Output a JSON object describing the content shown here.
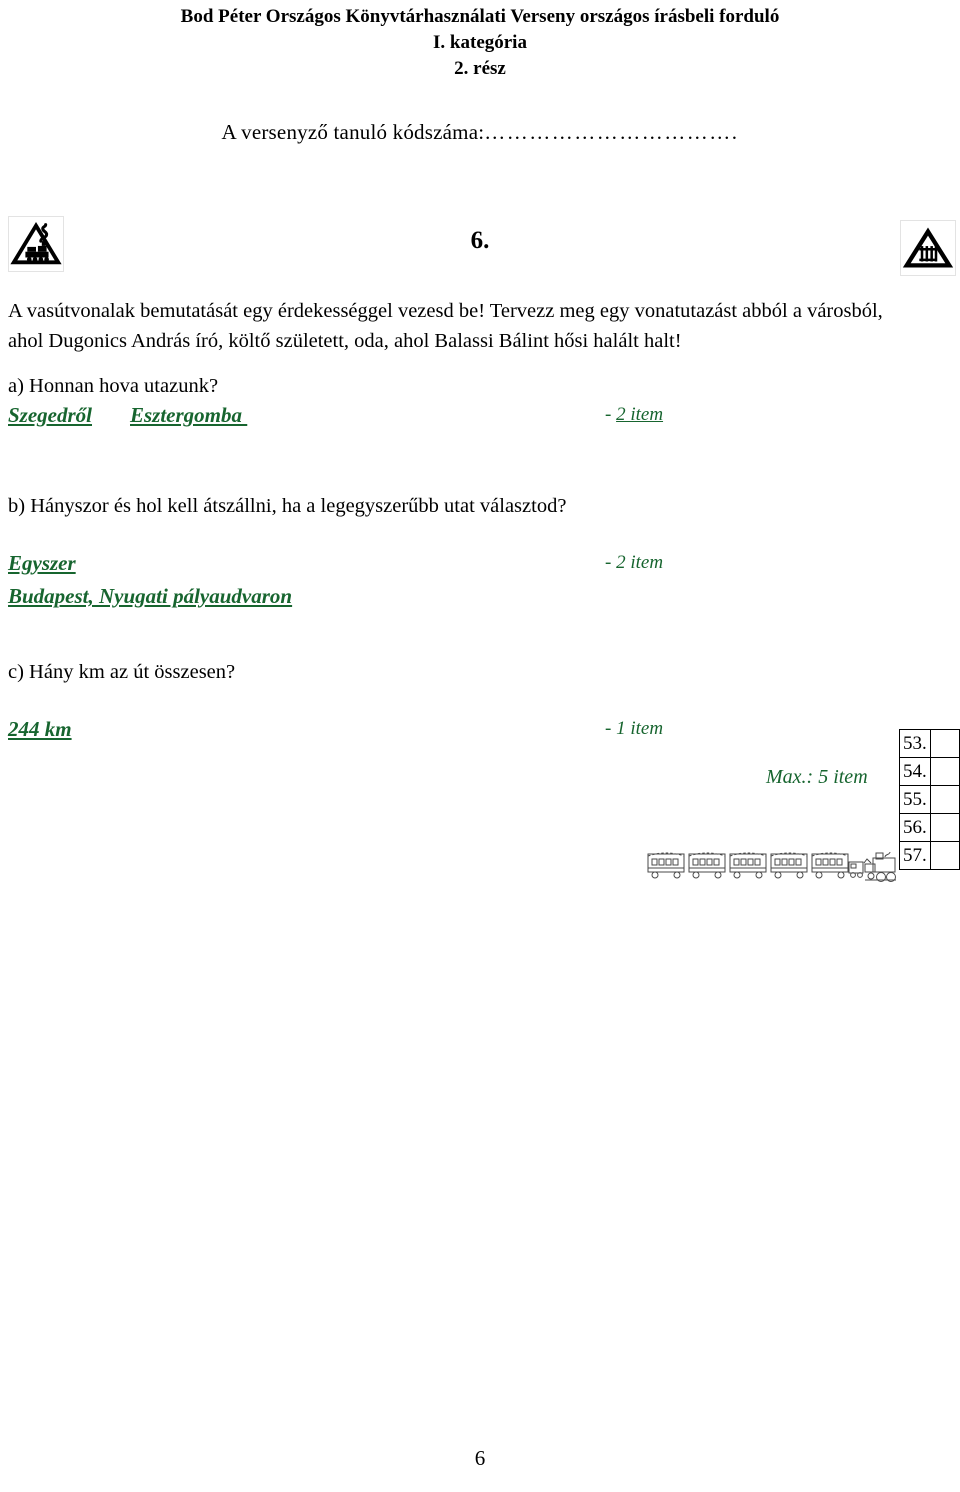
{
  "header": {
    "title_line1": "Bod Péter Országos Könyvtárhasználati Verseny országos írásbeli forduló",
    "title_line2": "I. kategória",
    "title_line3": "2. rész",
    "code_label": "A versenyző tanuló kódszáma:",
    "code_dots": "……………………………."
  },
  "icons": {
    "left": "railway-warning-locomotive-icon",
    "right": "railway-warning-crossing-gate-icon",
    "train": "steam-train-icon"
  },
  "question": {
    "number": "6.",
    "intro": "A vasútvonalak bemutatását egy érdekességgel vezesd be! Tervezz meg egy vonatutazást abból a városból, ahol Dugonics András író, költő született, oda, ahol Balassi Bálint hősi halált halt!"
  },
  "parts": [
    {
      "prompt": "a) Honnan hova utazunk?",
      "answers": [
        "Szegedről",
        "Esztergomba "
      ],
      "points": "- ",
      "points_value": "2 item",
      "points_underlined": true
    },
    {
      "prompt": "b) Hányszor és hol kell átszállni, ha a legegyszerűbb utat választod?",
      "answers": [
        "Egyszer",
        "Budapest, Nyugati pályaudvaron"
      ],
      "points": "- 2 item",
      "points_value": "",
      "points_underlined": false
    },
    {
      "prompt": "c) Hány km az út összesen?",
      "answers": [
        "244 km"
      ],
      "points": "- 1 item",
      "points_value": "",
      "points_underlined": false
    }
  ],
  "max_points": "Max.: 5 item",
  "score_table": {
    "rows": [
      {
        "number": "53.",
        "value": ""
      },
      {
        "number": "54.",
        "value": ""
      },
      {
        "number": "55.",
        "value": ""
      },
      {
        "number": "56.",
        "value": ""
      },
      {
        "number": "57.",
        "value": ""
      }
    ]
  },
  "footer": {
    "page_number": "6"
  },
  "colors": {
    "answer_green": "#17652f",
    "text_black": "#000000",
    "page_background": "#ffffff"
  }
}
